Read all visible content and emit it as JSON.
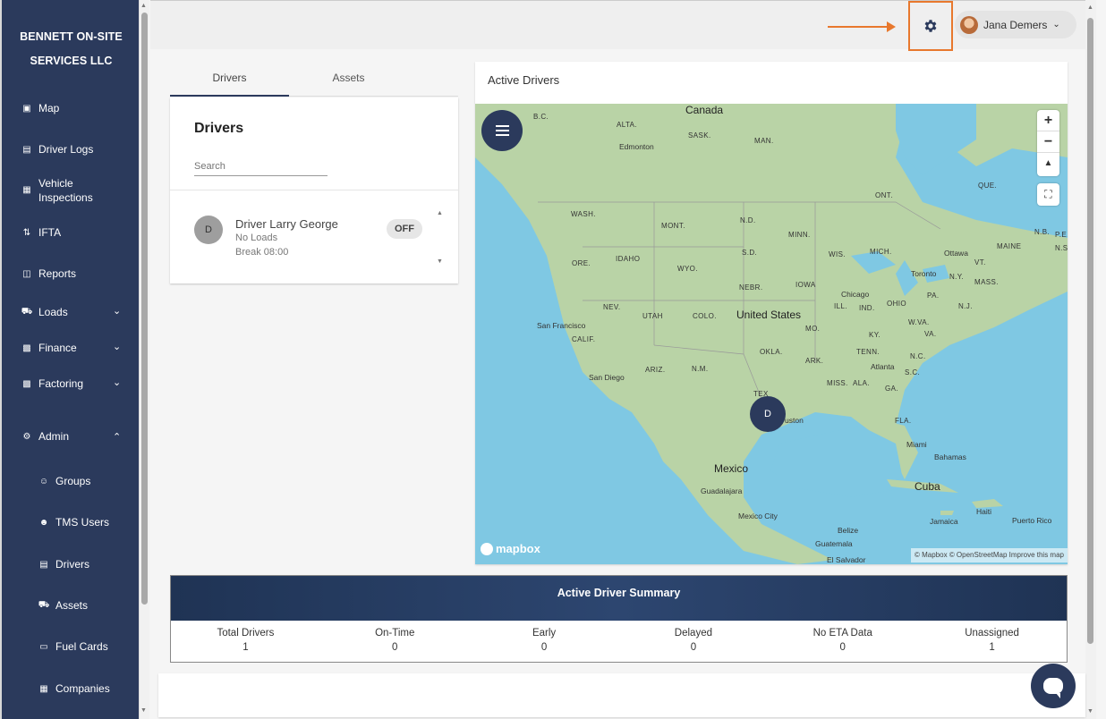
{
  "sidebar": {
    "brand_line1": "BENNETT ON-SITE",
    "brand_line2": "SERVICES LLC",
    "items": [
      {
        "label": "Map",
        "icon": "map-icon"
      },
      {
        "label": "Driver Logs",
        "icon": "clipboard-icon"
      },
      {
        "label_line1": "Vehicle",
        "label_line2": "Inspections",
        "icon": "inspection-icon"
      },
      {
        "label": "IFTA",
        "icon": "ifta-icon"
      },
      {
        "label": "Reports",
        "icon": "reports-icon"
      },
      {
        "label": "Loads",
        "icon": "truck-icon"
      },
      {
        "label": "Finance",
        "icon": "finance-icon"
      },
      {
        "label": "Factoring",
        "icon": "factoring-icon"
      },
      {
        "label": "Admin",
        "icon": "gear-icon"
      }
    ],
    "admin_subitems": [
      {
        "label": "Groups",
        "icon": "groups-icon"
      },
      {
        "label": "TMS Users",
        "icon": "users-icon"
      },
      {
        "label": "Drivers",
        "icon": "driver-badge-icon"
      },
      {
        "label": "Assets",
        "icon": "truck-icon"
      },
      {
        "label": "Fuel Cards",
        "icon": "card-icon"
      },
      {
        "label": "Companies",
        "icon": "building-icon"
      }
    ]
  },
  "header": {
    "user_name": "Jana Demers",
    "settings_icon": "gear-icon",
    "highlight_color": "#e8782d"
  },
  "left_panel": {
    "tabs": [
      "Drivers",
      "Assets"
    ],
    "active_tab": "Drivers",
    "title": "Drivers",
    "search_placeholder": "Search",
    "drivers": [
      {
        "initial": "D",
        "name": "Driver Larry George",
        "loads": "No Loads",
        "status_detail": "Break 08:00",
        "status": "OFF"
      }
    ]
  },
  "map_panel": {
    "title": "Active Drivers",
    "marker_initial": "D",
    "labels": {
      "canada": "Canada",
      "us": "United States",
      "mexico": "Mexico",
      "cuba": "Cuba",
      "bc": "B.C.",
      "alta": "ALTA.",
      "sask": "SASK.",
      "man": "MAN.",
      "ont": "ONT.",
      "que": "QUE.",
      "wash": "WASH.",
      "mont": "MONT.",
      "nd": "N.D.",
      "minn": "MINN.",
      "ore": "ORE.",
      "idaho": "IDAHO",
      "wyo": "WYO.",
      "sd": "S.D.",
      "wis": "WIS.",
      "mich": "MICH.",
      "nebr": "NEBR.",
      "iowa": "IOWA",
      "nev": "NEV.",
      "utah": "UTAH",
      "colo": "COLO.",
      "ill": "ILL.",
      "ind": "IND.",
      "ohio": "OHIO",
      "pa": "PA.",
      "ny": "N.Y.",
      "mass": "MASS.",
      "vt": "VT.",
      "maine": "MAINE",
      "nb": "N.B.",
      "pe": "P.E.",
      "ns": "N.S",
      "nj": "N.J.",
      "calif": "CALIF.",
      "mo": "MO.",
      "ky": "KY.",
      "wva": "W.VA.",
      "va": "VA.",
      "okla": "OKLA.",
      "ark": "ARK.",
      "tenn": "TENN.",
      "nc": "N.C.",
      "ariz": "ARIZ.",
      "nm": "N.M.",
      "sc": "S.C.",
      "miss": "MISS.",
      "ala": "ALA.",
      "ga": "GA.",
      "tex": "TEX",
      "fla": "FLA.",
      "edmonton": "Edmonton",
      "ottawa": "Ottawa",
      "toronto": "Toronto",
      "chicago": "Chicago",
      "san_francisco": "San Francisco",
      "san_diego": "San Diego",
      "atlanta": "Atlanta",
      "houston": "uston",
      "miami": "Miami",
      "bahamas": "Bahamas",
      "guadalajara": "Guadalajara",
      "mexico_city": "Mexico City",
      "belize": "Belize",
      "guatemala": "Guatemala",
      "el_salvador": "El Salvador",
      "haiti": "Haiti",
      "jamaica": "Jamaica",
      "puerto_rico": "Puerto Rico"
    },
    "logo": "mapbox",
    "attribution": "© Mapbox © OpenStreetMap Improve this map"
  },
  "summary": {
    "title": "Active Driver Summary",
    "columns": [
      {
        "label": "Total Drivers",
        "value": "1"
      },
      {
        "label": "On-Time",
        "value": "0"
      },
      {
        "label": "Early",
        "value": "0"
      },
      {
        "label": "Delayed",
        "value": "0"
      },
      {
        "label": "No ETA Data",
        "value": "0"
      },
      {
        "label": "Unassigned",
        "value": "1"
      }
    ]
  }
}
